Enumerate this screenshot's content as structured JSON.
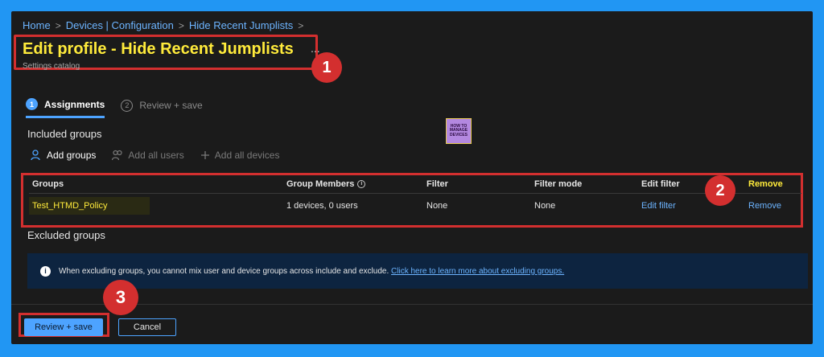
{
  "breadcrumb": [
    "Home",
    "Devices | Configuration",
    "Hide Recent Jumplists"
  ],
  "header": {
    "title": "Edit profile - Hide Recent Jumplists",
    "subtitle": "Settings catalog",
    "more": "..."
  },
  "badges": [
    "1",
    "2",
    "3"
  ],
  "tabs": [
    {
      "step": "1",
      "label": "Assignments"
    },
    {
      "step": "2",
      "label": "Review + save"
    }
  ],
  "included_label": "Included groups",
  "excluded_label": "Excluded groups",
  "logo": {
    "line1": "HOW TO",
    "line2": "MANAGE",
    "line3": "DEVICES"
  },
  "actions": {
    "add_groups": "Add groups",
    "add_all_users": "Add all users",
    "add_all_devices": "Add all devices"
  },
  "table": {
    "headers": [
      "Groups",
      "Group Members",
      "Filter",
      "Filter mode",
      "Edit filter",
      "Remove"
    ],
    "row": {
      "group": "Test_HTMD_Policy",
      "members": "1 devices, 0 users",
      "filter": "None",
      "filter_mode": "None",
      "edit_filter": "Edit filter",
      "remove": "Remove"
    }
  },
  "info": {
    "text": "When excluding groups, you cannot mix user and device groups across include and exclude.",
    "link": "Click here to learn more about excluding groups."
  },
  "footer": {
    "save": "Review + save",
    "cancel": "Cancel"
  },
  "colors": {
    "accent": "#4da3ff",
    "highlight": "#ffeb3b",
    "annotation": "#d32f2f",
    "page_bg": "#2196f3"
  }
}
